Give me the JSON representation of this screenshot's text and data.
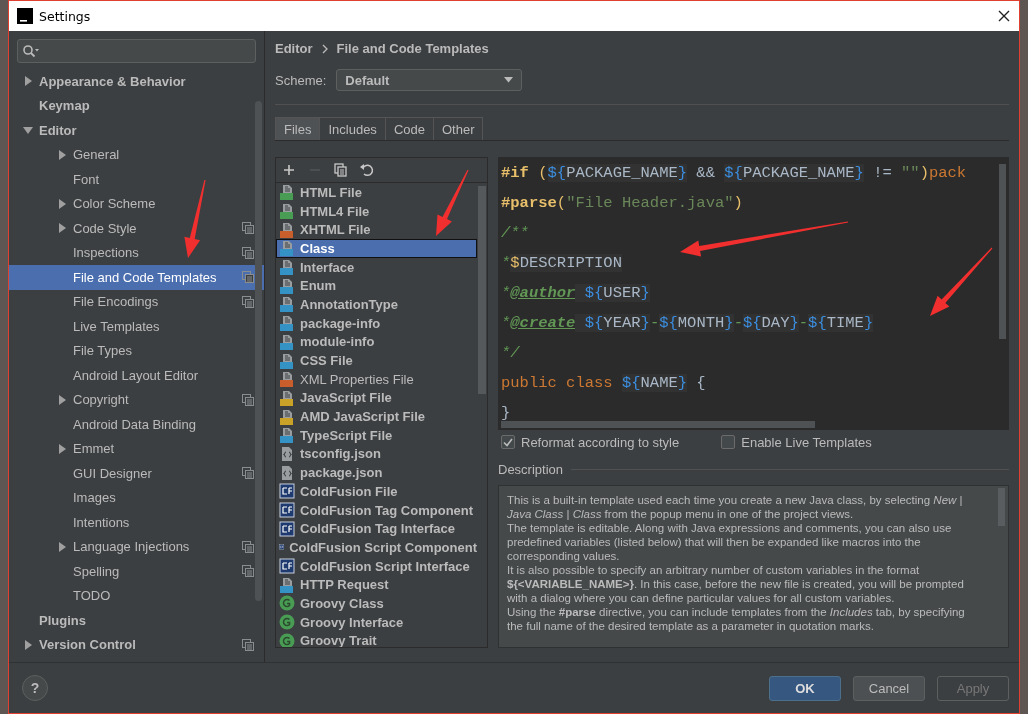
{
  "window": {
    "title": "Settings"
  },
  "sidebar": {
    "items": [
      {
        "label": "Appearance & Behavior",
        "expanded": false,
        "selected": false,
        "shared": false
      },
      {
        "label": "Keymap",
        "selected": false,
        "shared": false
      },
      {
        "label": "Editor",
        "expanded": true,
        "selected": false,
        "shared": false,
        "children": [
          {
            "label": "General",
            "expanded": false,
            "selected": false,
            "shared": false
          },
          {
            "label": "Font",
            "selected": false,
            "shared": false
          },
          {
            "label": "Color Scheme",
            "expanded": false,
            "selected": false,
            "shared": false
          },
          {
            "label": "Code Style",
            "expanded": false,
            "selected": false,
            "shared": true
          },
          {
            "label": "Inspections",
            "selected": false,
            "shared": true
          },
          {
            "label": "File and Code Templates",
            "selected": true,
            "shared": true
          },
          {
            "label": "File Encodings",
            "selected": false,
            "shared": true
          },
          {
            "label": "Live Templates",
            "selected": false,
            "shared": false
          },
          {
            "label": "File Types",
            "selected": false,
            "shared": false
          },
          {
            "label": "Android Layout Editor",
            "selected": false,
            "shared": false
          },
          {
            "label": "Copyright",
            "expanded": false,
            "selected": false,
            "shared": true
          },
          {
            "label": "Android Data Binding",
            "selected": false,
            "shared": false
          },
          {
            "label": "Emmet",
            "expanded": false,
            "selected": false,
            "shared": false
          },
          {
            "label": "GUI Designer",
            "selected": false,
            "shared": true
          },
          {
            "label": "Images",
            "selected": false,
            "shared": false
          },
          {
            "label": "Intentions",
            "selected": false,
            "shared": false
          },
          {
            "label": "Language Injections",
            "expanded": false,
            "selected": false,
            "shared": true
          },
          {
            "label": "Spelling",
            "selected": false,
            "shared": true
          },
          {
            "label": "TODO",
            "selected": false,
            "shared": false
          }
        ]
      },
      {
        "label": "Plugins",
        "selected": false,
        "shared": false
      },
      {
        "label": "Version Control",
        "expanded": false,
        "selected": false,
        "shared": true
      }
    ]
  },
  "breadcrumb": [
    "Editor",
    "File and Code Templates"
  ],
  "scheme": {
    "label": "Scheme:",
    "value": "Default"
  },
  "tabs": [
    {
      "label": "Files",
      "selected": true
    },
    {
      "label": "Includes",
      "selected": false
    },
    {
      "label": "Code",
      "selected": false
    },
    {
      "label": "Other",
      "selected": false
    }
  ],
  "toolbar": [
    {
      "kind": "add",
      "disabled": false
    },
    {
      "kind": "remove",
      "disabled": true
    },
    {
      "kind": "copy",
      "disabled": false
    },
    {
      "kind": "reset",
      "disabled": false
    }
  ],
  "templates": [
    {
      "name": "HTML File",
      "kind": "html",
      "bold": true,
      "selected": false
    },
    {
      "name": "HTML4 File",
      "kind": "html",
      "bold": true,
      "selected": false
    },
    {
      "name": "XHTML File",
      "kind": "xhtml",
      "bold": true,
      "selected": false
    },
    {
      "name": "Class",
      "kind": "java",
      "bold": true,
      "selected": true
    },
    {
      "name": "Interface",
      "kind": "java",
      "bold": true,
      "selected": false
    },
    {
      "name": "Enum",
      "kind": "java",
      "bold": true,
      "selected": false
    },
    {
      "name": "AnnotationType",
      "kind": "java",
      "bold": true,
      "selected": false
    },
    {
      "name": "package-info",
      "kind": "java",
      "bold": true,
      "selected": false
    },
    {
      "name": "module-info",
      "kind": "java",
      "bold": true,
      "selected": false
    },
    {
      "name": "CSS File",
      "kind": "css",
      "bold": true,
      "selected": false
    },
    {
      "name": "XML Properties File",
      "kind": "xml",
      "bold": false,
      "selected": false
    },
    {
      "name": "JavaScript File",
      "kind": "js",
      "bold": true,
      "selected": false
    },
    {
      "name": "AMD JavaScript File",
      "kind": "js",
      "bold": true,
      "selected": false
    },
    {
      "name": "TypeScript File",
      "kind": "ts",
      "bold": true,
      "selected": false
    },
    {
      "name": "tsconfig.json",
      "kind": "json",
      "bold": true,
      "selected": false
    },
    {
      "name": "package.json",
      "kind": "json",
      "bold": true,
      "selected": false
    },
    {
      "name": "ColdFusion File",
      "kind": "cf",
      "bold": true,
      "selected": false
    },
    {
      "name": "ColdFusion Tag Component",
      "kind": "cf",
      "bold": true,
      "selected": false
    },
    {
      "name": "ColdFusion Tag Interface",
      "kind": "cf",
      "bold": true,
      "selected": false
    },
    {
      "name": "ColdFusion Script Component",
      "kind": "cf",
      "bold": true,
      "selected": false
    },
    {
      "name": "ColdFusion Script Interface",
      "kind": "cf",
      "bold": true,
      "selected": false
    },
    {
      "name": "HTTP Request",
      "kind": "api",
      "bold": true,
      "selected": false
    },
    {
      "name": "Groovy Class",
      "kind": "groovy",
      "bold": true,
      "selected": false
    },
    {
      "name": "Groovy Interface",
      "kind": "groovy",
      "bold": true,
      "selected": false
    },
    {
      "name": "Groovy Trait",
      "kind": "groovy",
      "bold": true,
      "selected": false
    }
  ],
  "editor": {
    "lines": [
      [
        {
          "kind": "directive",
          "text": "#if"
        },
        {
          "kind": "paren",
          "text": " ("
        },
        {
          "kind": "brace",
          "text": "${"
        },
        {
          "kind": "varname",
          "text": "PACKAGE_NAME"
        },
        {
          "kind": "brace",
          "text": "}"
        },
        {
          "kind": "plain",
          "text": " && "
        },
        {
          "kind": "brace",
          "text": "${"
        },
        {
          "kind": "varname",
          "text": "PACKAGE_NAME"
        },
        {
          "kind": "brace",
          "text": "}"
        },
        {
          "kind": "plain",
          "text": " != "
        },
        {
          "kind": "string",
          "text": "\"\""
        },
        {
          "kind": "paren",
          "text": ")"
        },
        {
          "kind": "keyword",
          "text": "pack"
        }
      ],
      [
        {
          "kind": "directive",
          "text": "#parse"
        },
        {
          "kind": "paren",
          "text": "("
        },
        {
          "kind": "string",
          "text": "\"File Header.java\""
        },
        {
          "kind": "paren",
          "text": ")"
        }
      ],
      [
        {
          "kind": "comment",
          "text": "/**"
        }
      ],
      [
        {
          "kind": "comment",
          "text": "*"
        },
        {
          "kind": "dollar",
          "text": "$"
        },
        {
          "kind": "varname",
          "text": "DESCRIPTION"
        }
      ],
      [
        {
          "kind": "comment",
          "text": "*"
        },
        {
          "kind": "tag",
          "text": "@author"
        },
        {
          "kind": "brace",
          "text": " ${"
        },
        {
          "kind": "varname",
          "text": "USER"
        },
        {
          "kind": "brace",
          "text": "}"
        }
      ],
      [
        {
          "kind": "comment",
          "text": "*"
        },
        {
          "kind": "tag",
          "text": "@create"
        },
        {
          "kind": "brace",
          "text": " ${"
        },
        {
          "kind": "varname",
          "text": "YEAR"
        },
        {
          "kind": "brace",
          "text": "}"
        },
        {
          "kind": "comment",
          "text": "-"
        },
        {
          "kind": "brace",
          "text": "${"
        },
        {
          "kind": "varname",
          "text": "MONTH"
        },
        {
          "kind": "brace",
          "text": "}"
        },
        {
          "kind": "comment",
          "text": "-"
        },
        {
          "kind": "brace",
          "text": "${"
        },
        {
          "kind": "varname",
          "text": "DAY"
        },
        {
          "kind": "brace",
          "text": "}"
        },
        {
          "kind": "comment",
          "text": "-"
        },
        {
          "kind": "brace",
          "text": "${"
        },
        {
          "kind": "varname",
          "text": "TIME"
        },
        {
          "kind": "brace",
          "text": "}"
        }
      ],
      [
        {
          "kind": "comment",
          "text": "*/"
        }
      ],
      [
        {
          "kind": "keyword",
          "text": "public class "
        },
        {
          "kind": "brace",
          "text": "${"
        },
        {
          "kind": "varname",
          "text": "NAME"
        },
        {
          "kind": "brace",
          "text": "}"
        },
        {
          "kind": "plain",
          "text": " {"
        }
      ],
      [
        {
          "kind": "plain",
          "text": "}"
        }
      ]
    ]
  },
  "options": [
    {
      "label": "Reformat according to style",
      "checked": true
    },
    {
      "label": "Enable Live Templates",
      "checked": false
    }
  ],
  "description": {
    "heading": "Description",
    "paragraphs": [
      "This is a built-in template used each time you create a new Java class, by selecting *New* | *Java Class* | *Class* from the popup menu in one of the project views.",
      "The template is editable. Along with Java expressions and comments, you can also use predefined variables (listed below) that will then be expanded like macros into the corresponding values.",
      "It is also possible to specify an arbitrary number of custom variables in the format **${<VARIABLE_NAME>}**. In this case, before the new file is created, you will be prompted with a dialog where you can define particular values for all custom variables.",
      "Using the **#parse** directive, you can include templates from the *Includes* tab, by specifying the full name of the desired template as a parameter in quotation marks."
    ]
  },
  "help": "?",
  "buttons": [
    {
      "label": "OK",
      "kind": "default",
      "disabled": false
    },
    {
      "label": "Cancel",
      "kind": "normal",
      "disabled": false
    },
    {
      "label": "Apply",
      "kind": "normal",
      "disabled": true
    }
  ]
}
